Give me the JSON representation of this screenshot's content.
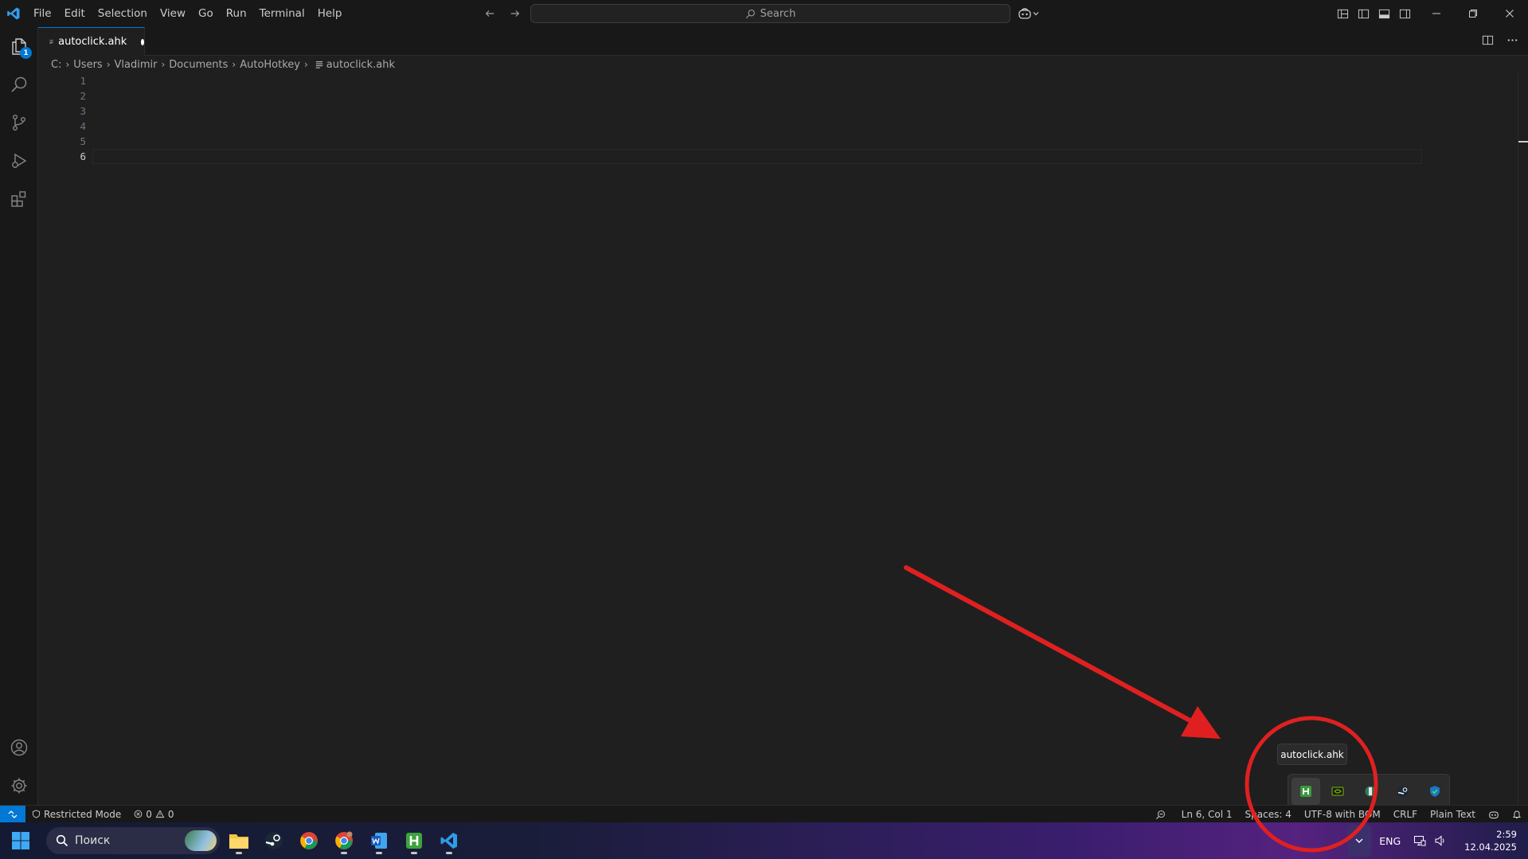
{
  "menu": [
    "File",
    "Edit",
    "Selection",
    "View",
    "Go",
    "Run",
    "Terminal",
    "Help"
  ],
  "search": {
    "label": "Search"
  },
  "activity_bar": {
    "explorer_badge": "1"
  },
  "tab": {
    "label": "autoclick.ahk"
  },
  "breadcrumb": [
    "C:",
    "Users",
    "Vladimir",
    "Documents",
    "AutoHotkey",
    "autoclick.ahk"
  ],
  "editor": {
    "line_numbers": [
      "1",
      "2",
      "3",
      "4",
      "5",
      "6"
    ],
    "active_line": "6"
  },
  "statusbar": {
    "restricted_mode": "Restricted Mode",
    "errors": "0",
    "warnings": "0",
    "position": "Ln 6, Col 1",
    "spaces": "Spaces: 4",
    "encoding": "UTF-8 with BOM",
    "eol": "CRLF",
    "language": "Plain Text"
  },
  "taskbar": {
    "search_placeholder": "Поиск",
    "language": "ENG",
    "time": "2:59",
    "date": "12.04.2025"
  },
  "tray_popup": {
    "tooltip": "autoclick.ahk"
  },
  "colors": {
    "accent": "#0078d4",
    "annotation": "#e02020",
    "editor_bg": "#1f1f1f",
    "chrome_bg": "#181818"
  }
}
